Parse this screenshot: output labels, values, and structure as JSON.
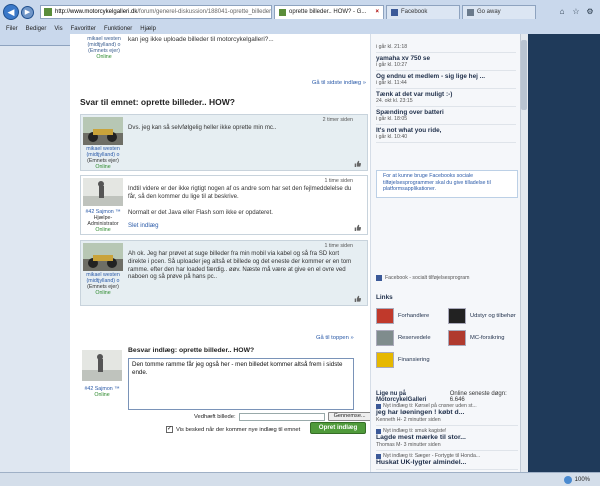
{
  "browser": {
    "url_host": "http://www.motorcykelgalleri.dk",
    "url_path": "/forum/generel-diskussion/188041-oprette_billeder_how",
    "tabs": [
      {
        "label": "oprette billeder.. HOW? - G...",
        "active": true
      },
      {
        "label": "Facebook",
        "active": false
      },
      {
        "label": "Go away",
        "active": false
      }
    ],
    "menu": [
      "Filer",
      "Bediger",
      "Vis",
      "Favoritter",
      "Funktioner",
      "Hjælp"
    ],
    "zoom": "100%"
  },
  "prev_post": {
    "author": "mikael westen (midtjylland) o",
    "role": "(Emnets ejer)",
    "status": "Online",
    "text": "kan jeg ikke uploade billeder til motorcykelgalleri?..."
  },
  "goto_last": "Gå til sidste indlæg »",
  "reply_title": "Svar til emnet: oprette billeder.. HOW?",
  "posts": [
    {
      "time": "2 timer siden",
      "author": "mikael westen (midtjylland) o",
      "role": "(Emnets ejer)",
      "status": "Online",
      "paragraphs": [
        "Dvs. jeg kan så selvfølgelig heller ikke oprette min mc.."
      ]
    },
    {
      "time": "1 time siden",
      "author": "#42 Sajmon ™",
      "role": "Hjælpe-Administrator",
      "status": "Online",
      "paragraphs": [
        "Indtil videre er der ikke rigtigt nogen af os andre som har set den fejlmeddelelse du får, så den kommer du lige til at beskrive.",
        "Normalt er det Java eller Flash som ikke er opdateret."
      ],
      "delete": "Slet indlæg"
    },
    {
      "time": "1 time siden",
      "author": "mikael westen (midtjylland) o",
      "role": "(Emnets ejer)",
      "status": "Online",
      "paragraphs": [
        "Ah ok. Jeg har prøvet at suge billeder fra min mobil via kabel og så fra SD kort direkte i pcen. Så uploader jeg altså et billede og det eneste der kommer er en tom ramme. efter den har loaded færdig.. øøv. Næste må være at give en el ovre ved naboen og så prøve på hans pc.."
      ]
    }
  ],
  "top_link": "Gå til toppen »",
  "answer": {
    "title": "Besvar indlæg: oprette billeder.. HOW?",
    "author": "#42 Sajmon ™",
    "status": "Online",
    "draft": "Den tomme ramme får jeg også her - men billedet kommer altså frem i sidste ende.",
    "attach_label": "Vedhæft billede:",
    "browse_label": "Gennemse...",
    "notify_label": "Vis besked når der kommer nye indlæg til emnet",
    "submit_label": "Opret indlæg"
  },
  "sidebar": {
    "recent": [
      {
        "title": "",
        "meta": "i går kl. 21:18"
      },
      {
        "title": "yamaha xv 750 se",
        "meta": "i går kl. 10:27"
      },
      {
        "title": "Og endnu et medlem - sig lige hej ...",
        "meta": "i går kl. 11:44"
      },
      {
        "title": "Tænk at det var muligt :-)",
        "meta": "24. okt kl. 23:15"
      },
      {
        "title": "Spænding over batteri",
        "meta": "i går kl. 18:05"
      },
      {
        "title": "It's not what you ride,",
        "meta": "i går kl. 10:40"
      }
    ],
    "fb_box": "For at kunne bruge Facebooks sociale tilføjelsesprogrammer skal du give tilladelse til platformsapplikationer.",
    "fb_note": "Facebook - socialt tilføjelsesprogram",
    "links_heading": "Links",
    "links": [
      {
        "label": "Forhandlere",
        "color": "#c0392b"
      },
      {
        "label": "Udstyr og tilbehør",
        "color": "#222222"
      },
      {
        "label": "Reservedele",
        "color": "#7f8c8d"
      },
      {
        "label": "MC-forsikring",
        "color": "#b03a2e"
      },
      {
        "label": "Finansiering",
        "color": "#e6b800"
      }
    ],
    "likes_heading": "Lige nu på MotorcykelGalleri",
    "likes_count": "Online seneste døgn: 6.646",
    "likes": [
      {
        "small": "Nyt indlæg ti: Kørsel på cnsner uden st...",
        "big": "jeg har løeningen ! købt d..."
      },
      {
        "small": "Kenneth H- 2 minutter siden",
        "big": ""
      },
      {
        "small": "Nyt indlæg ti: smuk kagiste!",
        "big": "Lagde mest mærke til stor..."
      },
      {
        "small": "Thomas M- 3 minutter siden",
        "big": ""
      },
      {
        "small": "Nyt indlæg ti: Sæger - Fortygte til Honda...",
        "big": "Huskat UK-lygter almindel..."
      }
    ]
  }
}
